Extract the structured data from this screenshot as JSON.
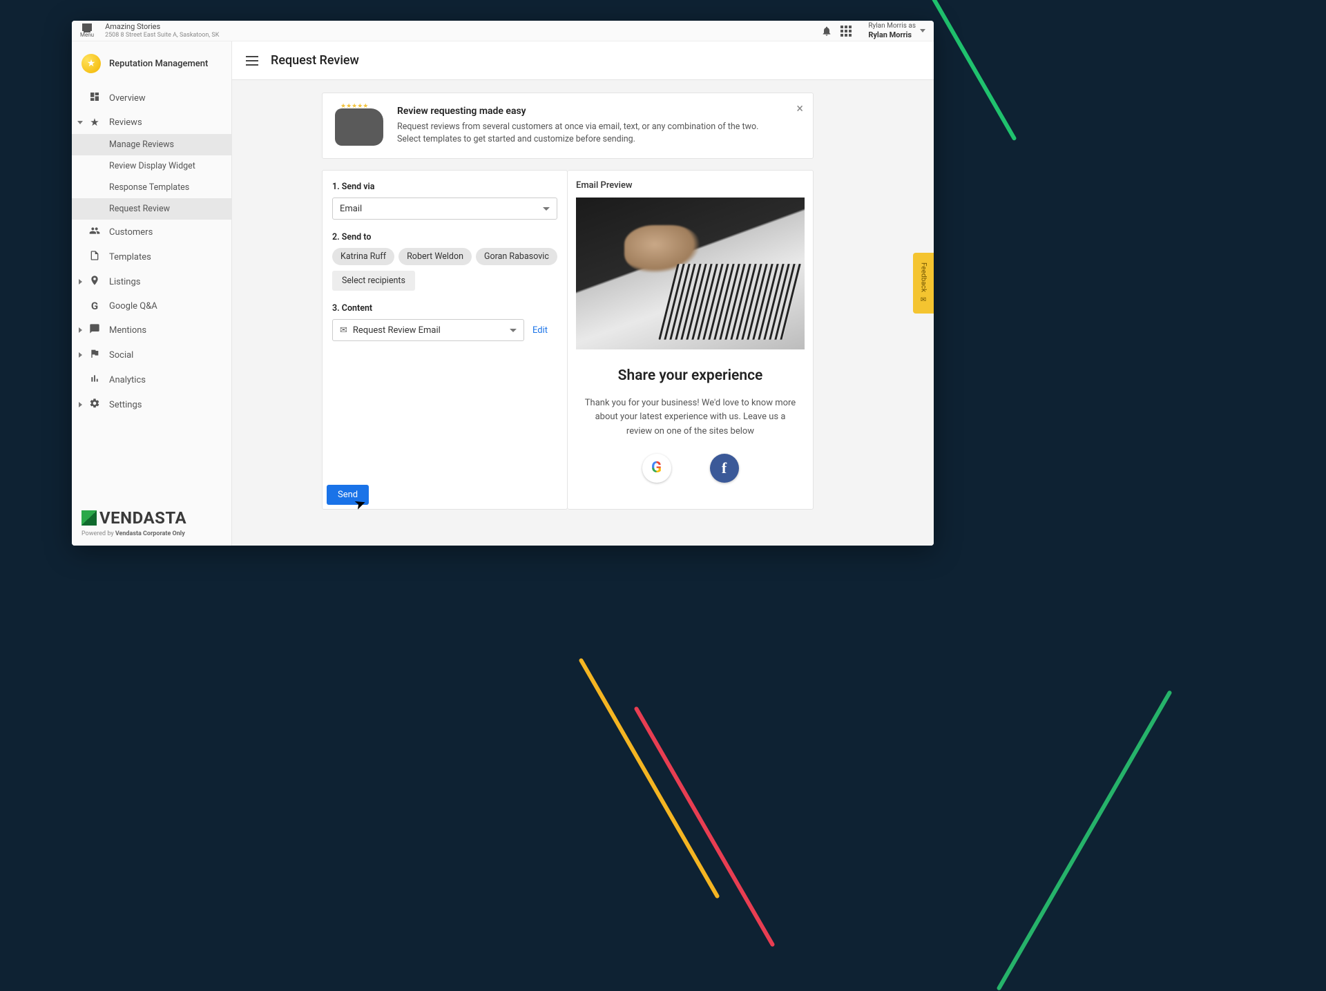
{
  "topbar": {
    "menu_label": "Menu",
    "business_name": "Amazing Stories",
    "business_address": "2508 8 Street East Suite A, Saskatoon, SK",
    "user_as": "Rylan Morris as",
    "user_name": "Rylan Morris"
  },
  "sidebar": {
    "app_name": "Reputation Management",
    "items": {
      "overview": "Overview",
      "reviews": "Reviews",
      "manage_reviews": "Manage Reviews",
      "review_display_widget": "Review Display Widget",
      "response_templates": "Response Templates",
      "request_review": "Request Review",
      "customers": "Customers",
      "templates": "Templates",
      "listings": "Listings",
      "google_qa": "Google Q&A",
      "mentions": "Mentions",
      "social": "Social",
      "analytics": "Analytics",
      "settings": "Settings"
    },
    "footer_brand": "VENDASTA",
    "powered_prefix": "Powered by ",
    "powered_name": "Vendasta Corporate Only"
  },
  "page": {
    "title": "Request Review"
  },
  "banner": {
    "title": "Review requesting made easy",
    "body": "Request reviews from several customers at once via email, text, or any combination of the two. Select templates to get started and customize before sending."
  },
  "form": {
    "step1_label": "1. Send via",
    "send_via_value": "Email",
    "step2_label": "2. Send to",
    "recipients": [
      "Katrina Ruff",
      "Robert Weldon",
      "Goran Rabasovic"
    ],
    "select_recipients": "Select recipients",
    "step3_label": "3. Content",
    "content_value": "Request Review Email",
    "edit": "Edit",
    "send": "Send"
  },
  "preview": {
    "heading": "Email Preview",
    "title": "Share your experience",
    "body": "Thank you for your business! We'd love to know more about your latest experience with us. Leave us a review on one of the sites below"
  },
  "feedback_tab": "Feedback"
}
